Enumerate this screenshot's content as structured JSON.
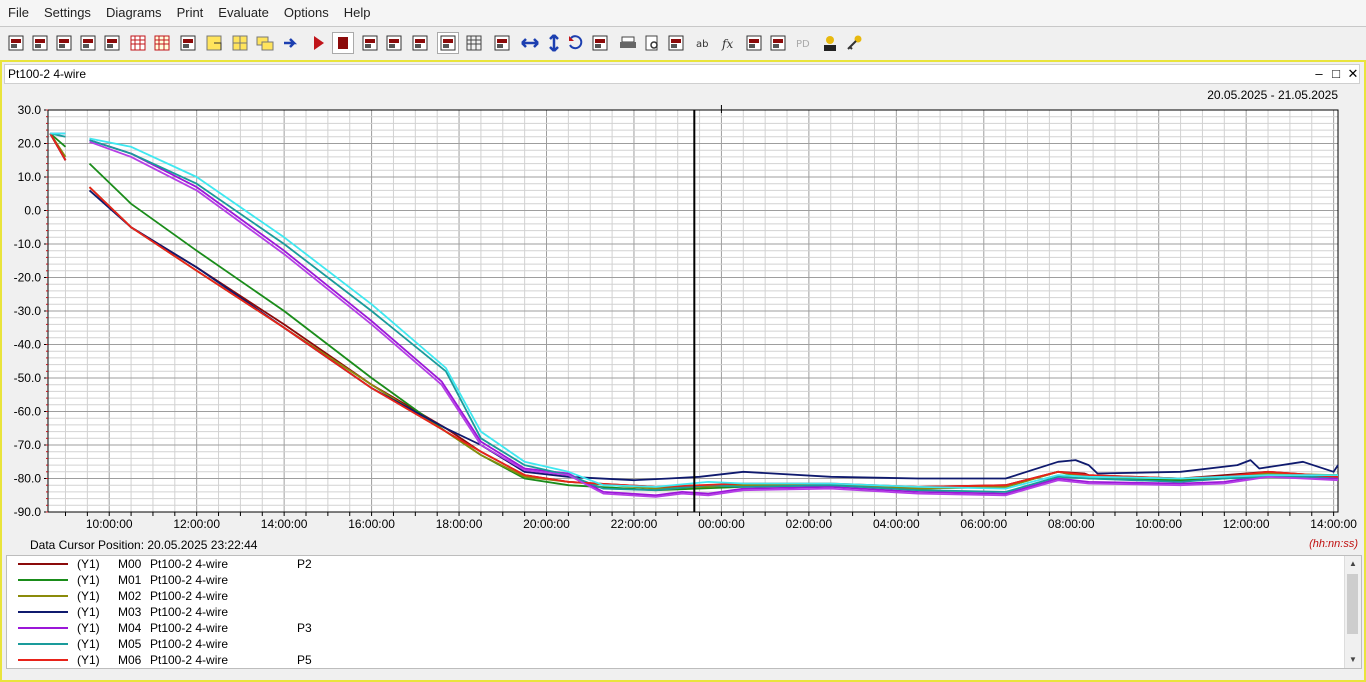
{
  "menu": [
    "File",
    "Settings",
    "Diagrams",
    "Print",
    "Evaluate",
    "Options",
    "Help"
  ],
  "toolbar_icons": [
    "open-icon",
    "save-icon",
    "new-window-icon",
    "print-setup-icon",
    "chart-bar-icon",
    "table-red-icon",
    "table-grid-icon",
    "copy-icon",
    "select-yellow-icon",
    "grid-yellow-icon",
    "stack-yellow-icon",
    "arrow-right-icon",
    "play-icon",
    "stop-icon",
    "zoom-area-icon",
    "zoom-cross-icon",
    "marker-icon",
    "fit-icon",
    "grid-toggle-icon",
    "autoscale-icon",
    "horizontal-zoom-icon",
    "vertical-zoom-icon",
    "undo-zoom-icon",
    "redo-zoom-icon",
    "printer-icon",
    "preview-icon",
    "export-icon",
    "text-label-icon",
    "formula-icon",
    "bracket-icon",
    "line-tool-icon",
    "pd-icon",
    "user-icon",
    "key-icon"
  ],
  "document": {
    "title": "Pt100-2 4-wire",
    "window_controls": [
      "–",
      "□",
      "✕"
    ]
  },
  "cursor_label": "Data Cursor Position: 20.05.2025 23:22:44",
  "time_format": "(hh:nn:ss)",
  "legend": [
    {
      "axis": "(Y1)",
      "channel": "M00",
      "name": "Pt100-2 4-wire",
      "point": "P2",
      "color": "#8b0a0a"
    },
    {
      "axis": "(Y1)",
      "channel": "M01",
      "name": "Pt100-2 4-wire",
      "point": "",
      "color": "#1a8c1a"
    },
    {
      "axis": "(Y1)",
      "channel": "M02",
      "name": "Pt100-2 4-wire",
      "point": "",
      "color": "#8b8b0a"
    },
    {
      "axis": "(Y1)",
      "channel": "M03",
      "name": "Pt100-2 4-wire",
      "point": "",
      "color": "#0f1a6e"
    },
    {
      "axis": "(Y1)",
      "channel": "M04",
      "name": "Pt100-2 4-wire",
      "point": "P3",
      "color": "#9b17d8"
    },
    {
      "axis": "(Y1)",
      "channel": "M05",
      "name": "Pt100-2 4-wire",
      "point": "",
      "color": "#1a9b9b"
    },
    {
      "axis": "(Y1)",
      "channel": "M06",
      "name": "Pt100-2 4-wire",
      "point": "P5",
      "color": "#e8231a"
    }
  ],
  "chart_data": {
    "type": "line",
    "date_range": "20.05.2025 - 21.05.2025",
    "x_unit": "hours since 20.05.2025 00:00",
    "xlim": [
      8.6,
      38.1
    ],
    "ylim": [
      -90,
      30
    ],
    "y_ticks": [
      "30.0",
      "20.0",
      "10.0",
      "0.0",
      "-10.0",
      "-20.0",
      "-30.0",
      "-40.0",
      "-50.0",
      "-60.0",
      "-70.0",
      "-80.0",
      "-90.0"
    ],
    "y_tick_values": [
      30,
      20,
      10,
      0,
      -10,
      -20,
      -30,
      -40,
      -50,
      -60,
      -70,
      -80,
      -90
    ],
    "x_ticks": [
      "10:00:00",
      "12:00:00",
      "14:00:00",
      "16:00:00",
      "18:00:00",
      "20:00:00",
      "22:00:00",
      "00:00:00",
      "02:00:00",
      "04:00:00",
      "06:00:00",
      "08:00:00",
      "10:00:00",
      "12:00:00",
      "14:00:00"
    ],
    "x_tick_values": [
      10,
      12,
      14,
      16,
      18,
      20,
      22,
      24,
      26,
      28,
      30,
      32,
      34,
      36,
      38
    ],
    "grid": true,
    "cursor_x": 23.38,
    "marker_x": 24,
    "colors": {
      "red": "#e8231a",
      "cyan": "#3fe8f0",
      "magenta": "#b53fe6"
    },
    "series": [
      {
        "name": "M00",
        "color": "#8b0a0a",
        "segments": [
          [
            [
              8.65,
              23
            ],
            [
              9.0,
              15
            ]
          ],
          [
            [
              9.55,
              7
            ],
            [
              10.5,
              -5
            ],
            [
              12,
              -17
            ],
            [
              14,
              -34
            ],
            [
              16,
              -52
            ],
            [
              17.7,
              -65
            ],
            [
              18.5,
              -72
            ],
            [
              19.5,
              -79
            ],
            [
              20.5,
              -81
            ],
            [
              22.5,
              -82.5
            ],
            [
              24.5,
              -82
            ],
            [
              26.5,
              -82
            ],
            [
              28.5,
              -82.5
            ],
            [
              30.5,
              -82
            ],
            [
              31.7,
              -78
            ],
            [
              32.3,
              -78.5
            ],
            [
              32.4,
              -79
            ],
            [
              34.5,
              -80
            ],
            [
              35.5,
              -79
            ],
            [
              36.5,
              -78
            ],
            [
              38.1,
              -79.5
            ]
          ]
        ]
      },
      {
        "name": "M01",
        "color": "#1a8c1a",
        "segments": [
          [
            [
              8.65,
              23
            ],
            [
              9.0,
              19
            ]
          ],
          [
            [
              9.55,
              14
            ],
            [
              10.5,
              2
            ],
            [
              12,
              -12
            ],
            [
              14,
              -30
            ],
            [
              16,
              -50
            ],
            [
              17.7,
              -66
            ],
            [
              18.5,
              -73
            ],
            [
              19.5,
              -80
            ],
            [
              20.5,
              -82
            ],
            [
              22.5,
              -83.5
            ],
            [
              24.5,
              -82.5
            ],
            [
              26.5,
              -82
            ],
            [
              28.5,
              -83
            ],
            [
              30.5,
              -82.5
            ],
            [
              31.7,
              -78
            ],
            [
              32.4,
              -80
            ],
            [
              34.5,
              -80.5
            ],
            [
              35.5,
              -80
            ],
            [
              36.5,
              -79
            ],
            [
              38.1,
              -79
            ]
          ]
        ]
      },
      {
        "name": "M02",
        "color": "#8b8b0a",
        "segments": [
          [
            [
              8.65,
              23
            ],
            [
              9.0,
              16
            ]
          ],
          [
            [
              9.55,
              7
            ],
            [
              10.5,
              -5
            ],
            [
              12,
              -18
            ],
            [
              14,
              -35
            ],
            [
              16,
              -52
            ],
            [
              17.7,
              -66
            ],
            [
              18.5,
              -73
            ],
            [
              19.5,
              -79.5
            ],
            [
              20.5,
              -81
            ],
            [
              22.5,
              -83
            ],
            [
              24.5,
              -82
            ],
            [
              26.5,
              -82
            ],
            [
              28.5,
              -83
            ],
            [
              30.5,
              -82.5
            ],
            [
              31.7,
              -78
            ],
            [
              32.4,
              -79.5
            ],
            [
              34.5,
              -80
            ],
            [
              35.5,
              -79.5
            ],
            [
              36.5,
              -78.5
            ],
            [
              38.1,
              -79
            ]
          ]
        ]
      },
      {
        "name": "M03",
        "color": "#0f1a6e",
        "segments": [
          [
            [
              8.65,
              23
            ],
            [
              9.0,
              15
            ]
          ],
          [
            [
              9.55,
              6
            ],
            [
              10.5,
              -5
            ],
            [
              12,
              -17
            ],
            [
              14,
              -35
            ],
            [
              16,
              -53
            ],
            [
              17.7,
              -65
            ],
            [
              18.5,
              -70
            ],
            [
              19.5,
              -78
            ],
            [
              20.5,
              -79.5
            ],
            [
              22.0,
              -80.5
            ],
            [
              22.8,
              -80
            ],
            [
              23.5,
              -79.5
            ],
            [
              24.5,
              -78
            ],
            [
              26.5,
              -79.5
            ],
            [
              28.5,
              -80
            ],
            [
              30.5,
              -80
            ],
            [
              31.7,
              -75
            ],
            [
              32.1,
              -74.5
            ],
            [
              32.4,
              -76
            ],
            [
              32.6,
              -78.5
            ],
            [
              34.5,
              -78
            ],
            [
              35.8,
              -76
            ],
            [
              36.1,
              -74.5
            ],
            [
              36.3,
              -77
            ],
            [
              37.3,
              -75
            ],
            [
              38.0,
              -78
            ],
            [
              38.1,
              -76
            ]
          ]
        ]
      },
      {
        "name": "M04",
        "color": "#9b17d8",
        "segments": [
          [
            [
              8.65,
              23
            ],
            [
              9.0,
              23
            ]
          ],
          [
            [
              9.55,
              21
            ],
            [
              10.5,
              17
            ],
            [
              12,
              7
            ],
            [
              14,
              -12
            ],
            [
              16,
              -33
            ],
            [
              17.6,
              -51
            ],
            [
              18.5,
              -69
            ],
            [
              19.5,
              -77
            ],
            [
              20.5,
              -78.5
            ],
            [
              21.3,
              -84
            ],
            [
              22.5,
              -85
            ],
            [
              23.1,
              -84
            ],
            [
              23.7,
              -84.5
            ],
            [
              24.5,
              -83
            ],
            [
              26.5,
              -82.5
            ],
            [
              28.5,
              -84
            ],
            [
              30.5,
              -84.5
            ],
            [
              31.7,
              -80
            ],
            [
              32.4,
              -81
            ],
            [
              34.5,
              -81.5
            ],
            [
              35.5,
              -81
            ],
            [
              36.5,
              -79
            ],
            [
              38.1,
              -80
            ]
          ]
        ]
      },
      {
        "name": "M05",
        "color": "#1a9b9b",
        "segments": [
          [
            [
              8.65,
              23
            ],
            [
              9.0,
              22
            ]
          ],
          [
            [
              9.55,
              21
            ],
            [
              10.5,
              17
            ],
            [
              12,
              8
            ],
            [
              14,
              -10
            ],
            [
              16,
              -30
            ],
            [
              17.7,
              -48
            ],
            [
              18.5,
              -68
            ],
            [
              19.5,
              -76
            ],
            [
              20.5,
              -79
            ],
            [
              21.3,
              -83
            ],
            [
              22.5,
              -83.5
            ],
            [
              23.7,
              -82
            ],
            [
              24.5,
              -82.5
            ],
            [
              26.5,
              -82
            ],
            [
              28.5,
              -83.5
            ],
            [
              30.5,
              -84
            ],
            [
              31.7,
              -79.5
            ],
            [
              32.4,
              -80
            ],
            [
              34.5,
              -81
            ],
            [
              35.5,
              -80
            ],
            [
              36.5,
              -79.5
            ],
            [
              38.1,
              -79.5
            ]
          ]
        ]
      },
      {
        "name": "M06",
        "color": "#e8231a",
        "segments": [
          [
            [
              8.65,
              23
            ],
            [
              9.0,
              15
            ]
          ],
          [
            [
              9.55,
              7
            ],
            [
              10.5,
              -5
            ],
            [
              12,
              -18
            ],
            [
              14,
              -35
            ],
            [
              16,
              -53
            ],
            [
              17.7,
              -66
            ],
            [
              18.5,
              -72
            ],
            [
              19.5,
              -79
            ],
            [
              20.5,
              -81
            ],
            [
              22.5,
              -82.5
            ],
            [
              24.5,
              -81.5
            ],
            [
              26.5,
              -81.5
            ],
            [
              28.5,
              -82.5
            ],
            [
              30.5,
              -82
            ],
            [
              31.7,
              -78
            ],
            [
              32.4,
              -79
            ],
            [
              34.5,
              -80
            ],
            [
              35.5,
              -79.5
            ],
            [
              36.5,
              -78
            ],
            [
              38.1,
              -79.5
            ]
          ]
        ]
      },
      {
        "name": "cyan",
        "color": "#3fe8f0",
        "segments": [
          [
            [
              8.65,
              23
            ],
            [
              9.0,
              23
            ]
          ],
          [
            [
              9.55,
              21.5
            ],
            [
              10.5,
              19
            ],
            [
              12,
              10
            ],
            [
              14,
              -8
            ],
            [
              16,
              -28
            ],
            [
              17.7,
              -47
            ],
            [
              18.5,
              -66
            ],
            [
              19.5,
              -75
            ],
            [
              20.5,
              -78
            ],
            [
              21.3,
              -82
            ],
            [
              22.5,
              -82.5
            ],
            [
              23.7,
              -81
            ],
            [
              24.5,
              -81.5
            ],
            [
              26.5,
              -81.5
            ],
            [
              28.5,
              -82.5
            ],
            [
              30.5,
              -83
            ],
            [
              31.7,
              -79
            ],
            [
              32.4,
              -79.5
            ],
            [
              34.5,
              -80
            ],
            [
              35.5,
              -79.5
            ],
            [
              36.5,
              -79
            ],
            [
              38.1,
              -79
            ]
          ]
        ]
      },
      {
        "name": "magenta",
        "color": "#b53fe6",
        "segments": [
          [
            [
              9.55,
              20.5
            ],
            [
              10.5,
              16
            ],
            [
              12,
              6
            ],
            [
              14,
              -13
            ],
            [
              16,
              -34
            ],
            [
              17.6,
              -52
            ],
            [
              18.5,
              -70
            ],
            [
              19.5,
              -77.5
            ],
            [
              20.5,
              -79
            ],
            [
              21.3,
              -84.5
            ],
            [
              22.5,
              -85.5
            ],
            [
              23.1,
              -84.5
            ],
            [
              23.7,
              -85
            ],
            [
              24.5,
              -83.5
            ],
            [
              26.5,
              -83
            ],
            [
              28.5,
              -84.5
            ],
            [
              30.5,
              -85
            ],
            [
              31.7,
              -80.5
            ],
            [
              32.4,
              -81.5
            ],
            [
              34.5,
              -82
            ],
            [
              35.5,
              -81.5
            ],
            [
              36.5,
              -79.5
            ],
            [
              38.1,
              -80.5
            ]
          ]
        ]
      }
    ]
  }
}
